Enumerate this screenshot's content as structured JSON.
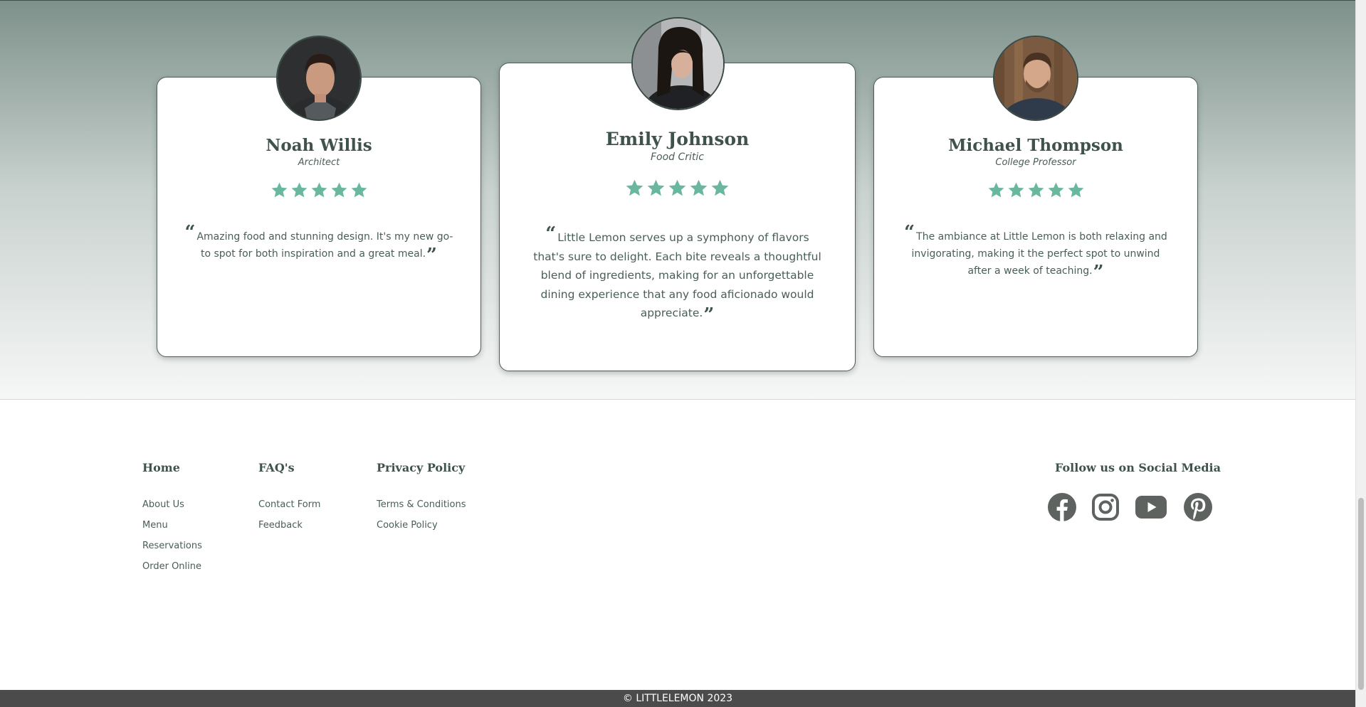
{
  "testimonials": [
    {
      "name": "Noah Willis",
      "role": "Architect",
      "rating": 5,
      "quote": "Amazing food and stunning design. It's my new go-to spot for both inspiration and a great meal."
    },
    {
      "name": "Emily Johnson",
      "role": "Food Critic",
      "rating": 5,
      "quote": "Little Lemon serves up a symphony of flavors that's sure to delight. Each bite reveals a thoughtful blend of ingredients, making for an unforgettable dining experience that any food aficionado would appreciate."
    },
    {
      "name": "Michael Thompson",
      "role": "College Professor",
      "rating": 5,
      "quote": "The ambiance at Little Lemon is both relaxing and invigorating, making it the perfect spot to unwind after a week of teaching."
    }
  ],
  "quote_marks": {
    "open": "“",
    "close": "”"
  },
  "footer": {
    "columns": [
      {
        "heading": "Home",
        "links": [
          "About Us",
          "Menu",
          "Reservations",
          "Order Online"
        ]
      },
      {
        "heading": "FAQ's",
        "links": [
          "Contact Form",
          "Feedback"
        ]
      },
      {
        "heading": "Privacy Policy",
        "links": [
          "Terms & Conditions",
          "Cookie Policy"
        ]
      }
    ],
    "social_title": "Follow us on Social Media",
    "social_icons": [
      "facebook-icon",
      "instagram-icon",
      "youtube-icon",
      "pinterest-icon"
    ],
    "copyright": "© LITTLELEMON 2023"
  },
  "colors": {
    "star": "#6ab7a0",
    "text": "#495e57",
    "social_icon": "#5f6360",
    "copyright_bar": "#4b4b4b"
  }
}
